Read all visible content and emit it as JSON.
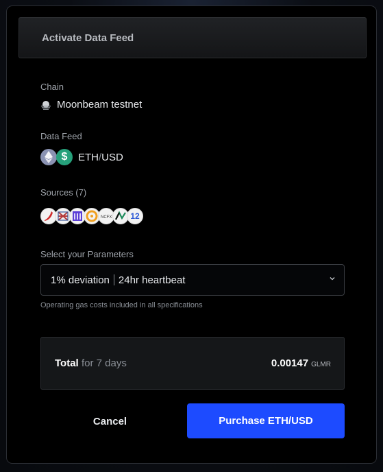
{
  "modal": {
    "title": "Activate Data Feed"
  },
  "chain": {
    "label": "Chain",
    "value": "Moonbeam testnet",
    "icon": "moonbeam-icon"
  },
  "data_feed": {
    "label": "Data Feed",
    "base": "ETH",
    "separator": "/",
    "quote": "USD",
    "icons": [
      "ethereum-icon",
      "usd-coin-icon"
    ],
    "colors": {
      "eth": "#8a92b2",
      "usd": "#26a17b"
    }
  },
  "sources": {
    "label": "Sources (7)",
    "icons": [
      "source-1-icon",
      "source-2-icon",
      "source-3-icon",
      "source-4-icon",
      "source-5-icon",
      "source-6-icon",
      "source-7-icon"
    ],
    "last_icon_text": "12"
  },
  "parameters": {
    "label": "Select your Parameters",
    "deviation": "1% deviation",
    "heartbeat": "24hr heartbeat",
    "hint": "Operating gas costs included in all specifications"
  },
  "total": {
    "label": "Total",
    "period": "for 7 days",
    "amount": "0.00147",
    "unit": "GLMR"
  },
  "actions": {
    "cancel": "Cancel",
    "purchase": "Purchase ETH/USD",
    "accent": "#1d4bff"
  }
}
